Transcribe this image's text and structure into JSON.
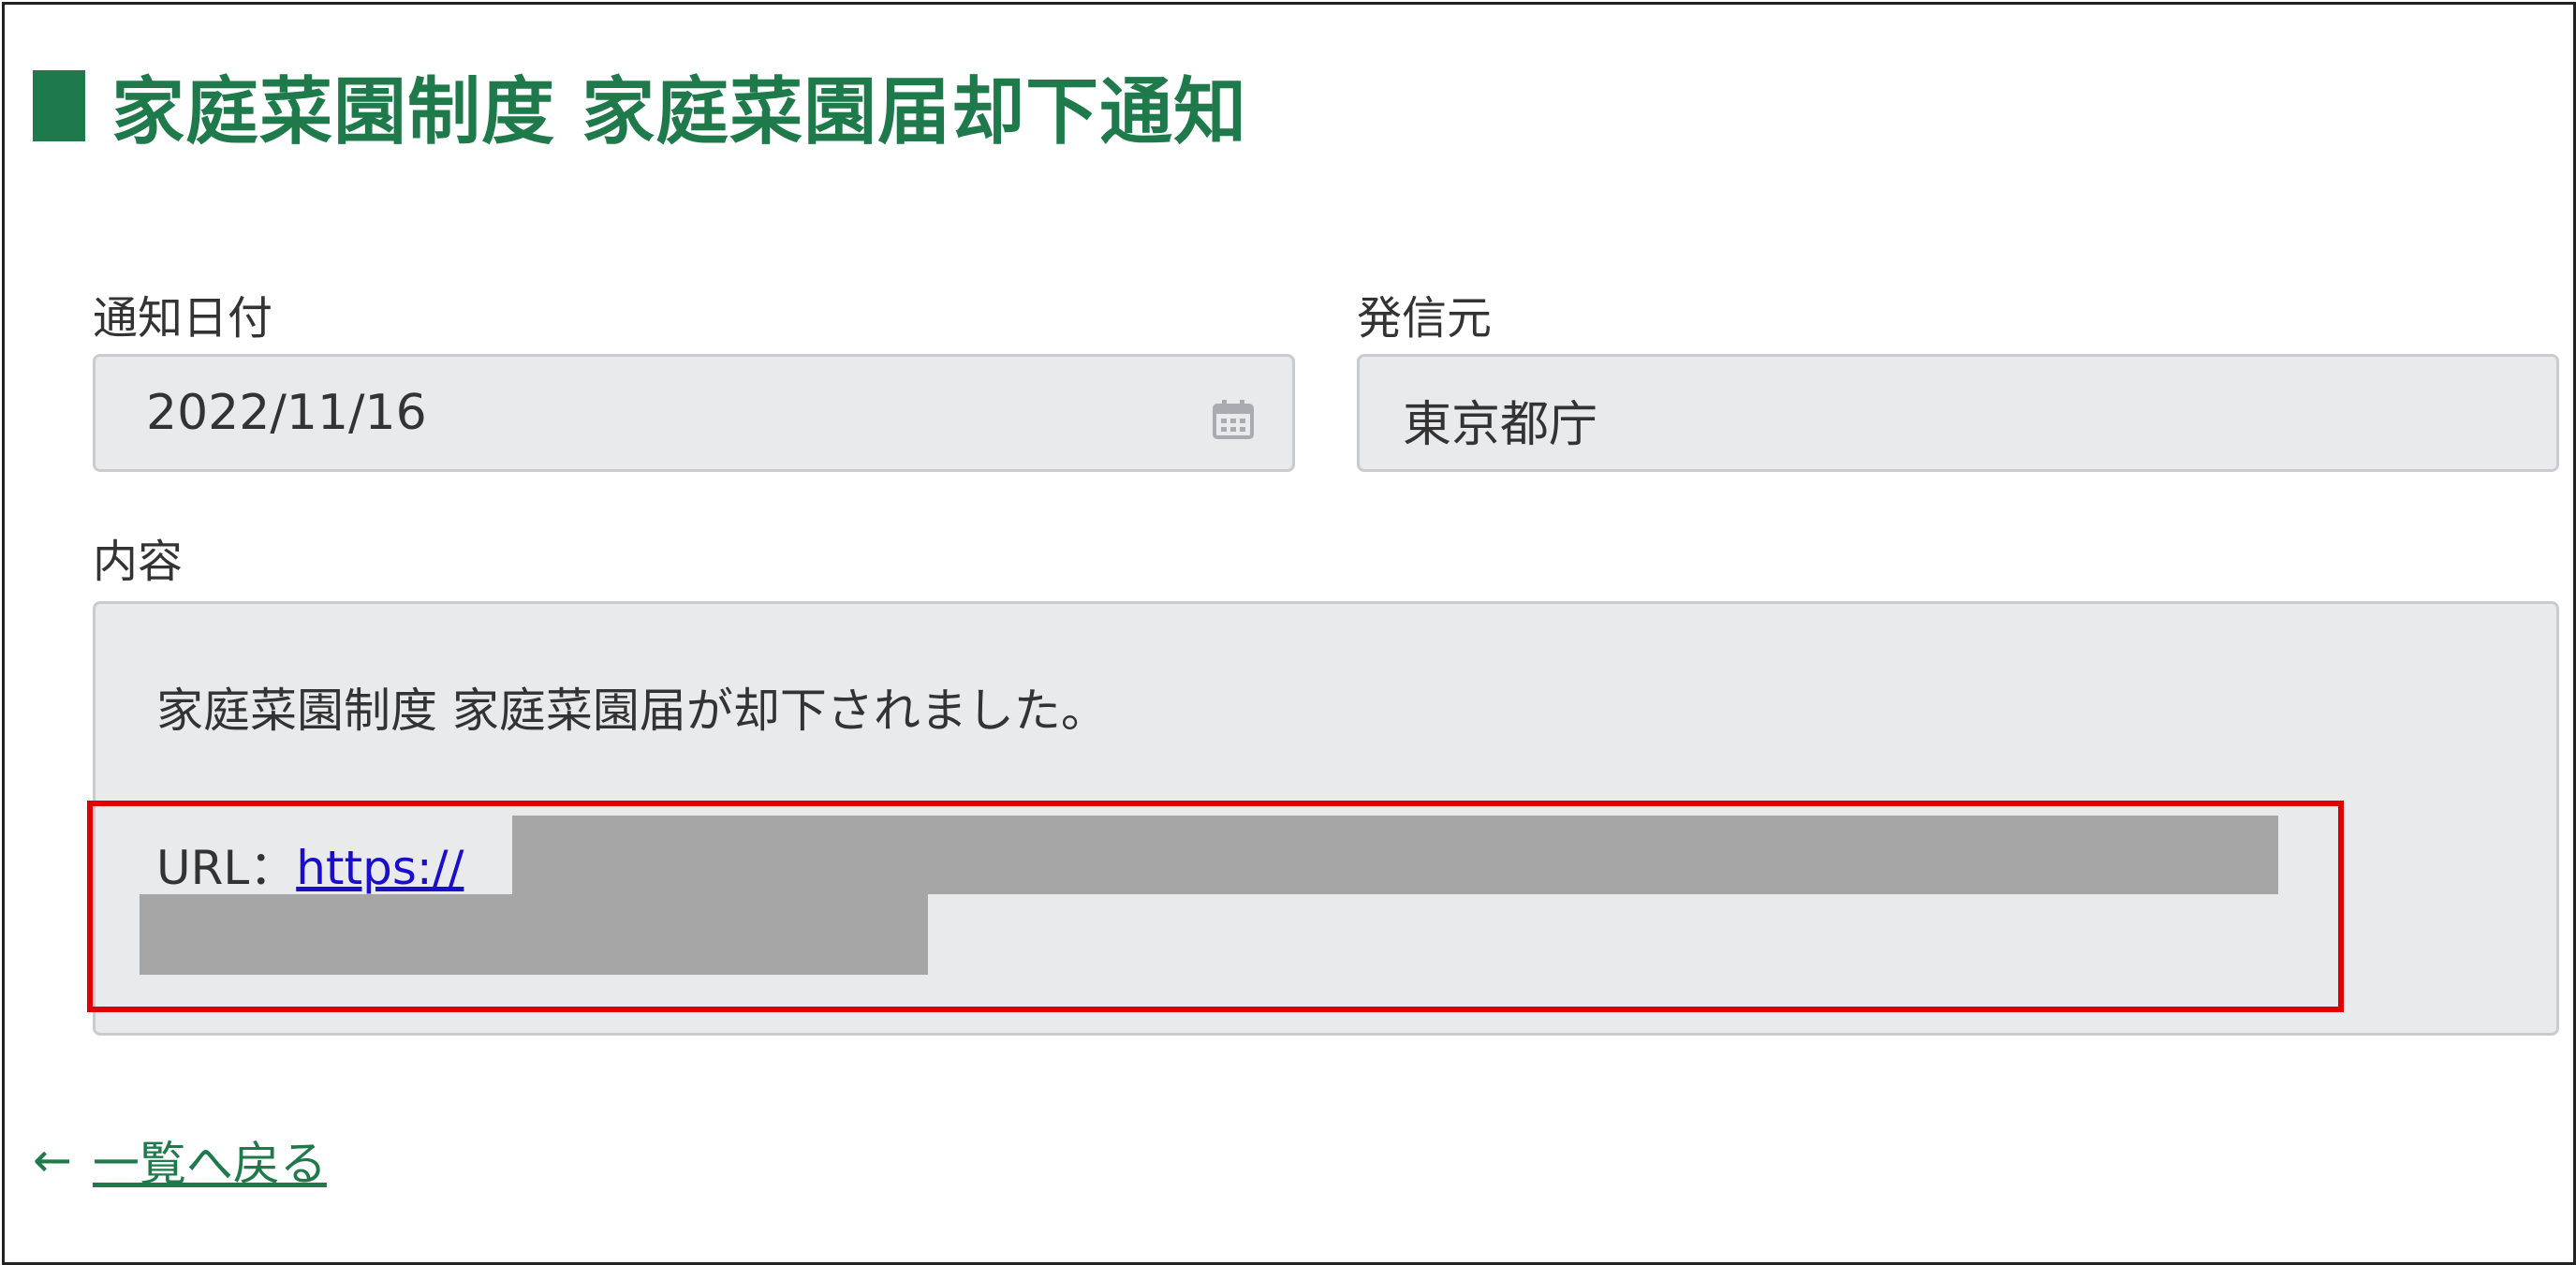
{
  "page": {
    "title": "家庭菜園制度 家庭菜園届却下通知"
  },
  "notification_date": {
    "label": "通知日付",
    "value": "2022/11/16",
    "icon": "calendar-icon"
  },
  "sender": {
    "label": "発信元",
    "value": "東京都庁"
  },
  "content": {
    "label": "内容",
    "message": "家庭菜園制度 家庭菜園届が却下されました。",
    "url_prefix": "URL：",
    "url_link": "https://"
  },
  "back": {
    "arrow": "←",
    "label": "一覧へ戻る"
  },
  "colors": {
    "accent": "#1e7a4a",
    "highlight": "#e00000",
    "link": "#1a0dcc",
    "field_bg": "#e9eaec",
    "redaction": "#a6a6a6"
  }
}
